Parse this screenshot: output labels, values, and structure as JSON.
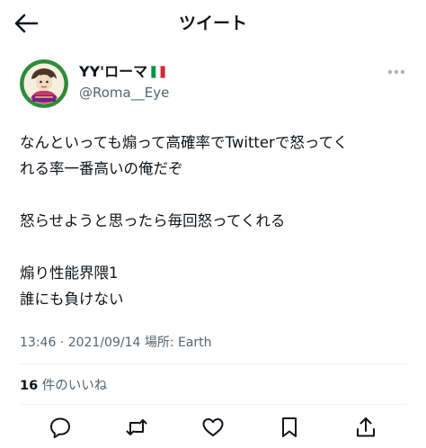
{
  "header": {
    "title": "ツイート",
    "back_icon": "arrow-left-icon"
  },
  "author": {
    "display_name": "YY'ローマ",
    "flag_icon": "italy-flag-icon",
    "handle": "@Roma__Eye",
    "avatar_icon": "avatar-icon",
    "more_icon": "more-horizontal-icon"
  },
  "tweet": {
    "lines": [
      "なんといっても煽って高確率でTwitterで怒ってく",
      "れる率一番高いの俺だぞ",
      "",
      "怒らせようと思ったら毎回怒ってくれる",
      "",
      "煽り性能界隈1",
      "誰にも負けない"
    ]
  },
  "meta": {
    "timestamp": "13:46 · 2021/09/14 場所: Earth"
  },
  "stats": {
    "likes_count": "16",
    "likes_label": " 件のいいね"
  },
  "actions": {
    "reply_icon": "reply-icon",
    "retweet_icon": "retweet-icon",
    "like_icon": "heart-icon",
    "bookmark_icon": "bookmark-icon",
    "share_icon": "share-icon"
  },
  "colors": {
    "text_primary": "#0f1419",
    "text_secondary": "#536471",
    "divider": "#eff3f4",
    "avatar_ring": "#2e8b3a",
    "avatar_fill": "#f6efe0"
  }
}
